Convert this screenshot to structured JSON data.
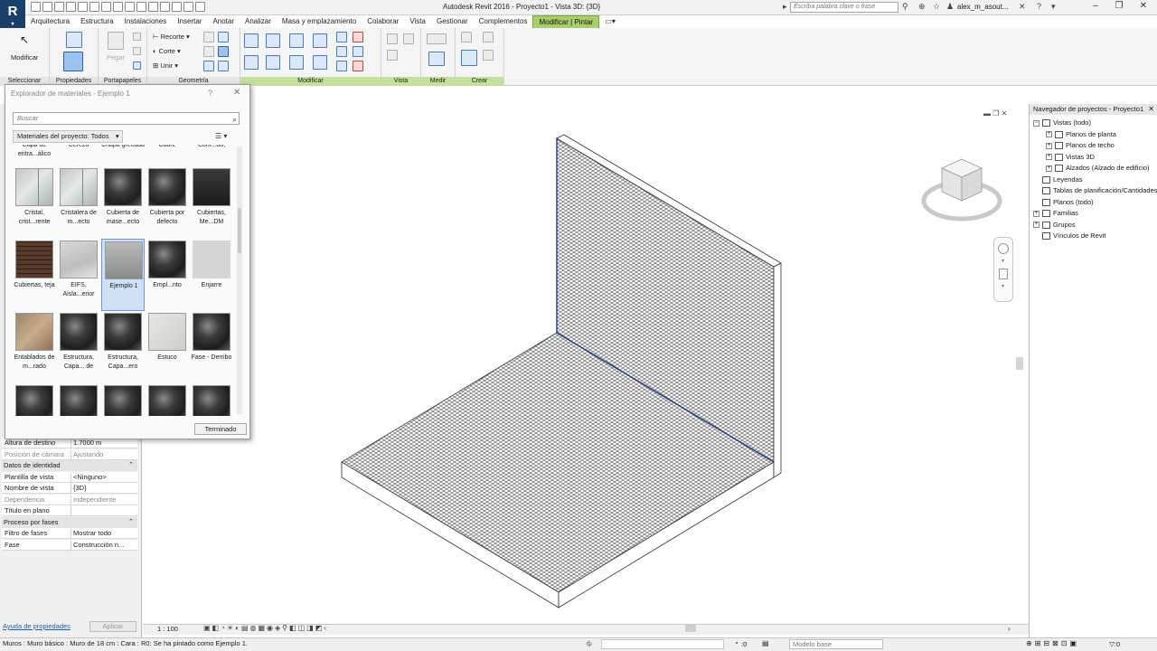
{
  "app": {
    "window_title": "Autodesk Revit 2016 -  Proyecto1 - Vista 3D: {3D}",
    "search_placeholder": "Escriba palabra clave o frase",
    "user": "alex_m_asout...",
    "logo": "R"
  },
  "tabs": [
    {
      "label": "Arquitectura"
    },
    {
      "label": "Estructura"
    },
    {
      "label": "Instalaciones"
    },
    {
      "label": "Insertar"
    },
    {
      "label": "Anotar"
    },
    {
      "label": "Analizar"
    },
    {
      "label": "Masa y emplazamiento"
    },
    {
      "label": "Colaborar"
    },
    {
      "label": "Vista"
    },
    {
      "label": "Gestionar"
    },
    {
      "label": "Complementos"
    },
    {
      "label": "Modificar | Pintar",
      "active": true
    }
  ],
  "ribbon": {
    "modify_label": "Modificar",
    "paste_label": "Pegar",
    "cope_label": "Recorte",
    "cut_label": "Corte",
    "join_label": "Unir",
    "panels": {
      "select": "Seleccionar",
      "properties": "Propiedades",
      "clipboard": "Portapapeles",
      "geometry": "Geometría",
      "modify": "Modificar",
      "view": "Vista",
      "measure": "Medir",
      "create": "Crear"
    }
  },
  "material_browser": {
    "title": "Explorador de materiales - Ejemplo 1",
    "help": "?",
    "search_placeholder": "Buscar",
    "filter": "Materiales del proyecto: Todos",
    "done_label": "Terminado",
    "top_row": [
      "Capa de entra...álico",
      "Cerezo",
      "Chapa grecada",
      "Cobre",
      "Cont...do,"
    ],
    "materials": [
      {
        "label": "Cristal, crist...rente",
        "swatch": "glass"
      },
      {
        "label": "Cristalera de m...ecto",
        "swatch": "glass"
      },
      {
        "label": "Cubierta de mase...ecto",
        "swatch": "sphere"
      },
      {
        "label": "Cubierta por defecto",
        "swatch": "sphere"
      },
      {
        "label": "Cubiertas, Me...DM",
        "swatch": "dark"
      },
      {
        "label": "Cubiertas, teja",
        "swatch": "brick"
      },
      {
        "label": "EIFS, Aisla...erior",
        "swatch": "light"
      },
      {
        "label": "Ejemplo 1",
        "swatch": "box",
        "selected": true
      },
      {
        "label": "Empl...nto",
        "swatch": "sphere"
      },
      {
        "label": "Enjarre",
        "swatch": "blank"
      },
      {
        "label": "Entablados de m...rado",
        "swatch": "wood"
      },
      {
        "label": "Estructura, Capa... de",
        "swatch": "sphere"
      },
      {
        "label": "Estructura, Capa...ero",
        "swatch": "sphere"
      },
      {
        "label": "Estuco",
        "swatch": "stucco"
      },
      {
        "label": "Fase - Derribo",
        "swatch": "sphere"
      },
      {
        "label": "",
        "swatch": "sphere"
      },
      {
        "label": "",
        "swatch": "sphere"
      },
      {
        "label": "",
        "swatch": "sphere"
      },
      {
        "label": "",
        "swatch": "sphere"
      },
      {
        "label": "",
        "swatch": "sphere"
      }
    ]
  },
  "properties": {
    "rows": [
      {
        "key": "Altura de destino",
        "value": "1.7000 m",
        "grey": false
      },
      {
        "key": "Posición de cámara",
        "value": "Ajustando",
        "grey": true
      }
    ],
    "identity_section": "Datos de identidad",
    "identity_rows": [
      {
        "key": "Plantilla de vista",
        "value": "<Ninguno>",
        "grey": false
      },
      {
        "key": "Nombre de vista",
        "value": "{3D}",
        "grey": false
      },
      {
        "key": "Dependencia",
        "value": "Independiente",
        "grey": true
      },
      {
        "key": "Título en plano",
        "value": "",
        "grey": false
      }
    ],
    "phasing_section": "Proceso por fases",
    "phasing_rows": [
      {
        "key": "Filtro de fases",
        "value": "Mostrar todo",
        "grey": false
      },
      {
        "key": "Fase",
        "value": "Construcción n...",
        "grey": false
      }
    ],
    "help_link": "Ayuda de propiedades",
    "apply_label": "Aplicar"
  },
  "project_browser": {
    "title": "Navegador de proyectos - Proyecto1",
    "items": [
      {
        "label": "Vistas (todo)",
        "level": 0,
        "expander": "-"
      },
      {
        "label": "Planos de planta",
        "level": 1,
        "expander": "+"
      },
      {
        "label": "Planos de techo",
        "level": 1,
        "expander": "+"
      },
      {
        "label": "Vistas 3D",
        "level": 1,
        "expander": "+"
      },
      {
        "label": "Alzados (Alzado de edificio)",
        "level": 1,
        "expander": "+"
      },
      {
        "label": "Leyendas",
        "level": 0,
        "expander": ""
      },
      {
        "label": "Tablas de planificación/Cantidades",
        "level": 0,
        "expander": ""
      },
      {
        "label": "Planos (todo)",
        "level": 0,
        "expander": ""
      },
      {
        "label": "Familias",
        "level": 0,
        "expander": "+"
      },
      {
        "label": "Grupos",
        "level": 0,
        "expander": "+"
      },
      {
        "label": "Vínculos de Revit",
        "level": 0,
        "expander": ""
      }
    ]
  },
  "viewbar": {
    "scale": "1 : 100"
  },
  "status": {
    "message": "Muros : Muro básico : Muro de 18 cm : Cara : R0: Se ha pintado como Ejemplo 1.",
    "zero": ":0",
    "model": "Modelo base"
  }
}
